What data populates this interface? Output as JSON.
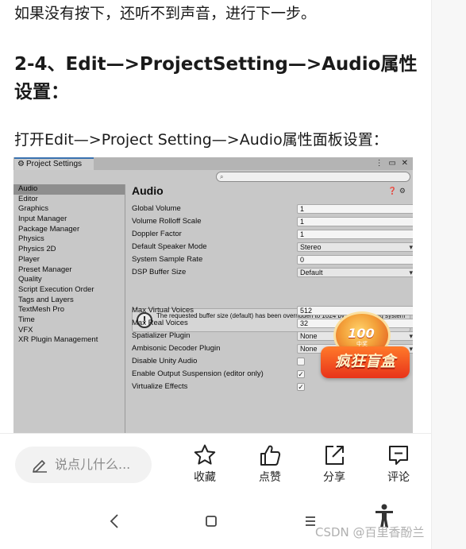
{
  "article": {
    "para1": "如果没有按下，还听不到声音，进行下一步。",
    "heading": "2-4、Edit—>ProjectSetting—>Audio属性设置：",
    "para2": "打开Edit—>Project Setting—>Audio属性面板设置："
  },
  "unity": {
    "tab_title": "Project Settings",
    "window_buttons": "⋮ ▭ ✕",
    "search_placeholder": "",
    "sidebar": [
      "Audio",
      "Editor",
      "Graphics",
      "Input Manager",
      "Package Manager",
      "Physics",
      "Physics 2D",
      "Player",
      "Preset Manager",
      "Quality",
      "Script Execution Order",
      "Tags and Layers",
      "TextMesh Pro",
      "Time",
      "VFX",
      "XR Plugin Management"
    ],
    "selected": "Audio",
    "heading": "Audio",
    "rows": [
      {
        "label": "Global Volume",
        "value": "1"
      },
      {
        "label": "Volume Rolloff Scale",
        "value": "1"
      },
      {
        "label": "Doppler Factor",
        "value": "1"
      },
      {
        "label": "Default Speaker Mode",
        "value": "Stereo"
      },
      {
        "label": "System Sample Rate",
        "value": "0"
      },
      {
        "label": "DSP Buffer Size",
        "value": "Default"
      },
      {
        "label": "Max Virtual Voices",
        "value": "512"
      },
      {
        "label": "Max Real Voices",
        "value": "32"
      },
      {
        "label": "Spatializer Plugin",
        "value": "None"
      },
      {
        "label": "Ambisonic Decoder Plugin",
        "value": "None"
      },
      {
        "label": "Disable Unity Audio",
        "checked": false
      },
      {
        "label": "Enable Output Suspension (editor only)",
        "checked": true
      },
      {
        "label": "Virtualize Effects",
        "checked": true
      }
    ],
    "warning": "The requested buffer size (default) has been overridden to 1024 by the operating system"
  },
  "promo": {
    "number": "100",
    "small": "中奖",
    "text": "疯狂盲盒"
  },
  "actionbar": {
    "comment_placeholder": "说点儿什么...",
    "favorite": "收藏",
    "like": "点赞",
    "share": "分享",
    "comment": "评论"
  },
  "watermark": "CSDN @百里香酚兰",
  "colors": {
    "unity_bg": "#c8c8c8",
    "unity_selected": "#8e8e8e",
    "tab_accent": "#3a72b0",
    "promo_red": "#e8331a"
  }
}
